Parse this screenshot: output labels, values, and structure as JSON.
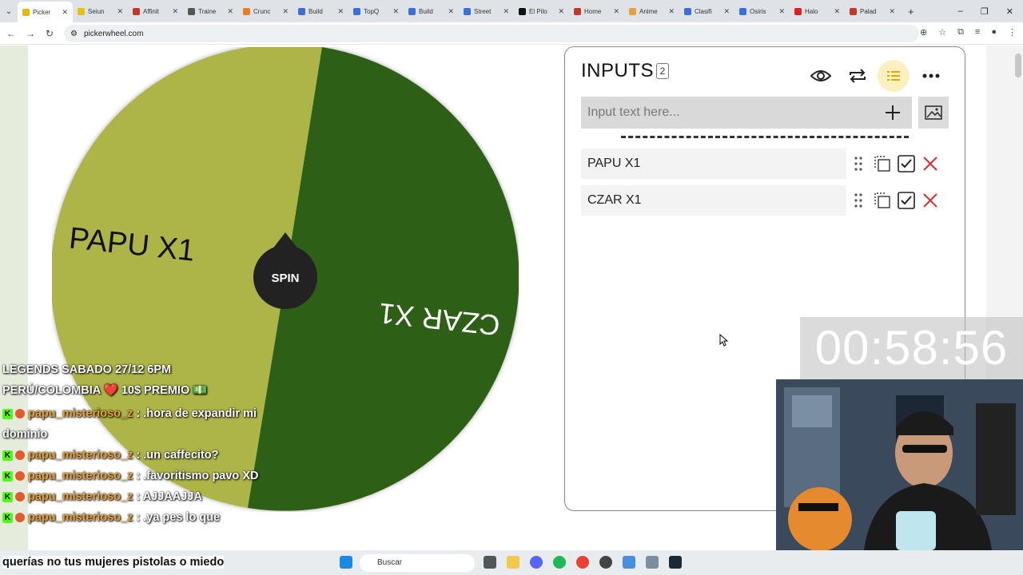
{
  "browser": {
    "tabs": [
      {
        "label": "Picker",
        "color": "#e6b800",
        "active": true
      },
      {
        "label": "Seiun",
        "color": "#e6c200"
      },
      {
        "label": "Affinit",
        "color": "#c0392b"
      },
      {
        "label": "Traine",
        "color": "#555555"
      },
      {
        "label": "Crunc",
        "color": "#e67e22"
      },
      {
        "label": "Build",
        "color": "#3b6fd6"
      },
      {
        "label": "TopQ",
        "color": "#3b6fd6"
      },
      {
        "label": "Build",
        "color": "#3b6fd6"
      },
      {
        "label": "Street",
        "color": "#3b6fd6"
      },
      {
        "label": "El Pilo",
        "color": "#111111"
      },
      {
        "label": "Home",
        "color": "#c0392b"
      },
      {
        "label": "Anime",
        "color": "#e6a23c"
      },
      {
        "label": "Clasifi",
        "color": "#3b6fd6"
      },
      {
        "label": "Osiris",
        "color": "#3b6fd6"
      },
      {
        "label": "Halo",
        "color": "#e02020"
      },
      {
        "label": "Palad",
        "color": "#c0392b"
      }
    ],
    "url": "pickerwheel.com"
  },
  "wheel": {
    "spin_label": "SPIN",
    "slices": [
      {
        "label": "CZAR X1",
        "color": "#adb548"
      },
      {
        "label": "PAPU X1",
        "color": "#2d5e12"
      }
    ]
  },
  "panel": {
    "title": "INPUTS",
    "count": "2",
    "input_placeholder": "Input text here...",
    "entries": [
      "PAPU X1",
      "CZAR X1"
    ],
    "accent": "#fcefc0"
  },
  "stream": {
    "timer": "00:58:56",
    "banner_line1": "LEGENDS SABADO 27/12 6PM",
    "banner_line2": "PERÚ/COLOMBIA ❤️ 10$ PREMIO 💵",
    "messages": [
      {
        "user": "papu_misterioso_z",
        "text": ": .hora de expandir mi dominio"
      },
      {
        "user": "papu_misterioso_z",
        "text": ": .un caffecito?"
      },
      {
        "user": "papu_misterioso_z",
        "text": ": .favoritismo pavo XD"
      },
      {
        "user": "papu_misterioso_z",
        "text": ": AJJAAJJA"
      },
      {
        "user": "papu_misterioso_z",
        "text": ": .ya pes lo que"
      }
    ],
    "caption": "querías no tus mujeres pistolas o miedo"
  },
  "taskbar": {
    "search": "Buscar"
  }
}
